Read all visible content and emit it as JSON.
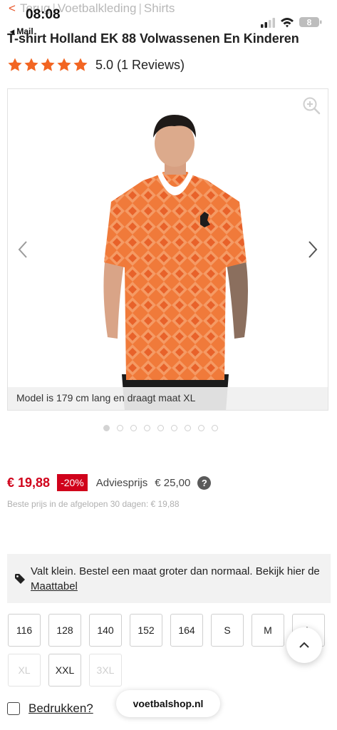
{
  "status_bar": {
    "time": "08:08",
    "back_app": "◂ Mail",
    "battery": "8"
  },
  "breadcrumb": {
    "back_icon": "chevron-left-icon",
    "items": [
      "Terug",
      "Voetbalkleding",
      "Shirts"
    ]
  },
  "product": {
    "title": "T-shirt Holland EK 88 Volwassenen En Kinderen",
    "rating_value": 5,
    "rating_text": "5.0 (1 Reviews)",
    "image_caption": "Model is 179 cm lang en draagt maat XL",
    "image_count": 9,
    "active_image": 0,
    "price": "€ 19,88",
    "discount": "-20%",
    "advies_label": "Adviesprijs",
    "advies_price": "€ 25,00",
    "best_price_note": "Beste prijs in de afgelopen 30 dagen: € 19,88"
  },
  "size_note": {
    "text": "Valt klein. Bestel een maat groter dan normaal. Bekijk hier de",
    "link": "Maattabel"
  },
  "sizes": [
    {
      "label": "116",
      "available": true
    },
    {
      "label": "128",
      "available": true
    },
    {
      "label": "140",
      "available": true
    },
    {
      "label": "152",
      "available": true
    },
    {
      "label": "164",
      "available": true
    },
    {
      "label": "S",
      "available": true
    },
    {
      "label": "M",
      "available": true
    },
    {
      "label": "L",
      "available": true
    },
    {
      "label": "XL",
      "available": false
    },
    {
      "label": "XXL",
      "available": true
    },
    {
      "label": "3XL",
      "available": false
    }
  ],
  "print_option": {
    "label": "Bedrukken?"
  },
  "browser": {
    "url": "voetbalshop.nl"
  },
  "colors": {
    "accent": "#e8572a",
    "price_red": "#d0021b",
    "star": "#f26522",
    "shirt_orange": "#f07a3a"
  }
}
